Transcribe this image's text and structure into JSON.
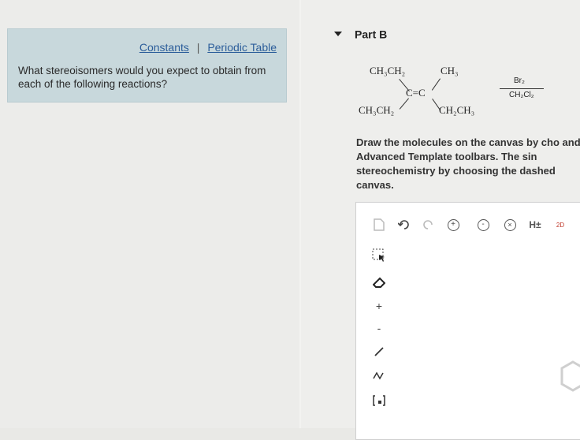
{
  "links": {
    "constants": "Constants",
    "separator": "|",
    "periodic_table": "Periodic Table"
  },
  "question": "What stereoisomers would you expect to obtain from each of the following reactions?",
  "part": {
    "label": "Part B"
  },
  "reaction": {
    "top_left": "CH₃CH₂",
    "top_right": "CH₃",
    "center": "C=C",
    "bottom_left": "CH₃CH₂",
    "bottom_right": "CH₂CH₃",
    "reagent": "Br₂",
    "solvent": "CH₂Cl₂"
  },
  "instructions": "Draw the molecules on the canvas by cho and Advanced Template toolbars. The sin stereochemistry by choosing the dashed canvas.",
  "toolbar": {
    "hpm_label": "H±",
    "two_d_label": "2D",
    "plus_label": "+",
    "minus_label": "-"
  }
}
